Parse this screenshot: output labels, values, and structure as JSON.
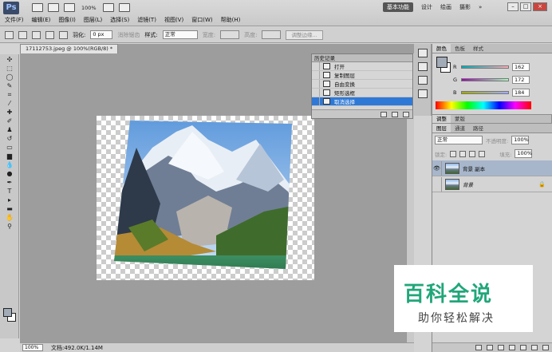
{
  "app": {
    "logo": "Ps",
    "zoom": "100%"
  },
  "workspaces": [
    "基本功能",
    "设计",
    "绘画",
    "摄影"
  ],
  "workspace_more": "»",
  "window_buttons": [
    "–",
    "□",
    "×"
  ],
  "menu": [
    "文件(F)",
    "编辑(E)",
    "图像(I)",
    "图层(L)",
    "选择(S)",
    "滤镜(T)",
    "视图(V)",
    "窗口(W)",
    "帮助(H)"
  ],
  "options": {
    "feather_label": "羽化:",
    "feather_value": "0 px",
    "antialias": "消除锯齿",
    "style_label": "样式:",
    "style_value": "正常",
    "width_label": "宽度:",
    "height_label": "高度:",
    "refine_button": "调整边缘..."
  },
  "document": {
    "tab": "17112753.jpeg @ 100%(RGB/8) *",
    "status_zoom": "100%",
    "status_doc": "文档:492.0K/1.14M"
  },
  "history": {
    "title": "历史记录",
    "items": [
      "打开",
      "复制图层",
      "自由变换",
      "矩形选框",
      "取消选择"
    ],
    "selected_index": 4
  },
  "color_panel": {
    "tabs": [
      "颜色",
      "色板",
      "样式"
    ],
    "R": "162",
    "G": "172",
    "B": "184",
    "fg": "#a2acb8"
  },
  "adjust_tabs": [
    "调整",
    "蒙版"
  ],
  "layers": {
    "tabs": [
      "图层",
      "通道",
      "路径"
    ],
    "blend_mode": "正常",
    "opacity_label": "不透明度:",
    "opacity": "100%",
    "lock_label": "锁定:",
    "fill_label": "填充:",
    "fill": "100%",
    "items": [
      {
        "name": "背景 副本",
        "visible": true
      },
      {
        "name": "背景",
        "visible": false
      }
    ]
  },
  "watermark": {
    "title": "百科全说",
    "subtitle": "助你轻松解决"
  }
}
